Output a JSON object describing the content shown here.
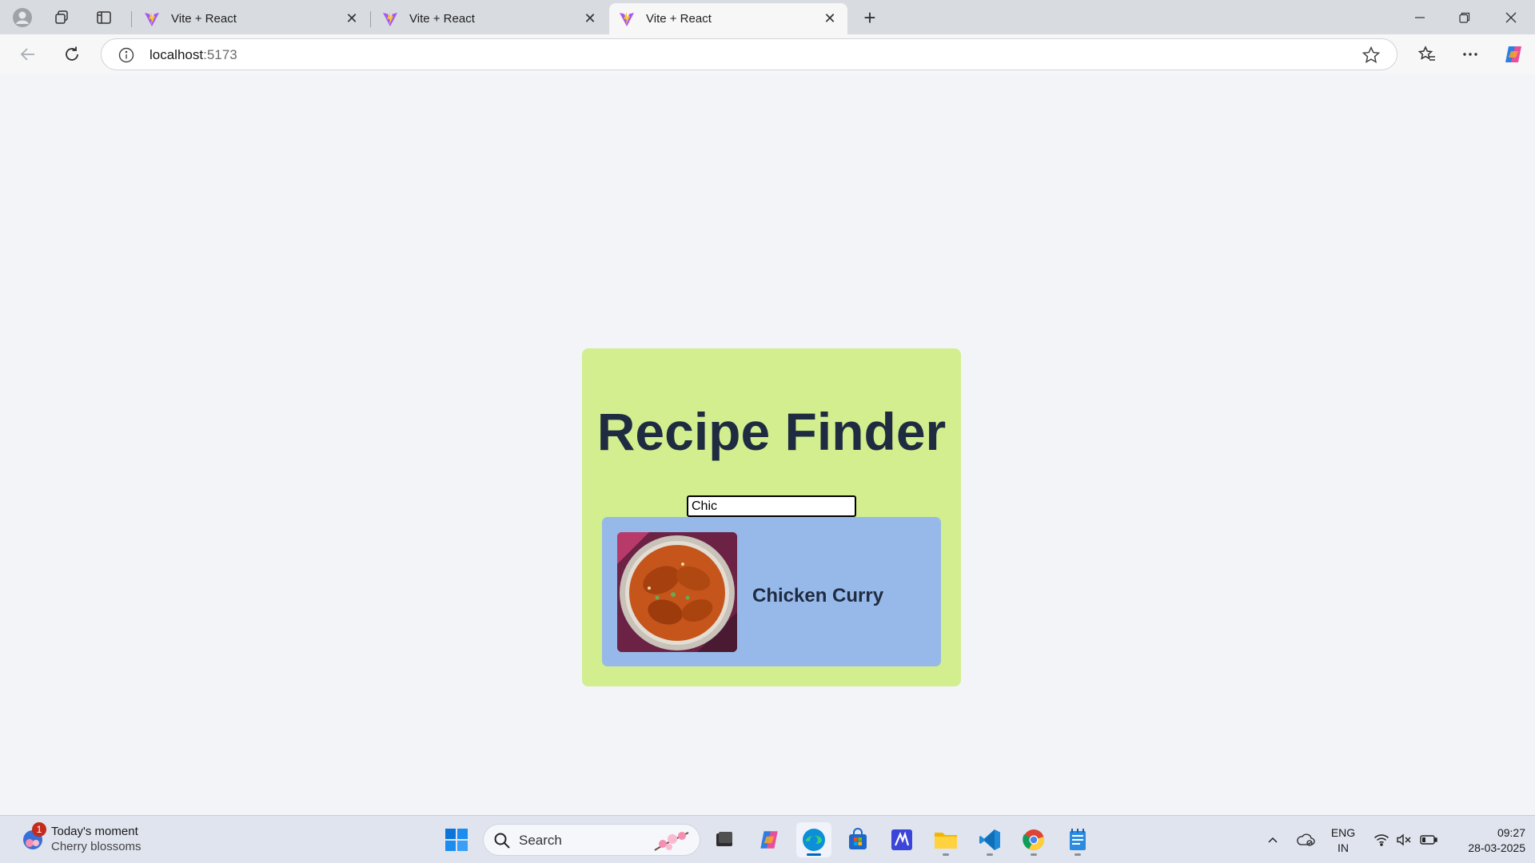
{
  "browser": {
    "tabs": [
      {
        "title": "Vite + React",
        "active": false
      },
      {
        "title": "Vite + React",
        "active": false
      },
      {
        "title": "Vite + React",
        "active": true
      }
    ],
    "url_host": "localhost",
    "url_port": ":5173"
  },
  "app": {
    "title": "Recipe Finder",
    "search_value": "Chic",
    "results": [
      {
        "name": "Chicken Curry"
      }
    ]
  },
  "taskbar": {
    "moment_title": "Today's moment",
    "moment_subtitle": "Cherry blossoms",
    "moment_badge": "1",
    "search_label": "Search",
    "lang_line1": "ENG",
    "lang_line2": "IN",
    "time": "09:27",
    "date": "28-03-2025"
  },
  "colors": {
    "card_bg": "#d2ee8e",
    "result_bg": "#97b9ea",
    "heading": "#1f2b41",
    "page_bg": "#f3f4f8"
  }
}
